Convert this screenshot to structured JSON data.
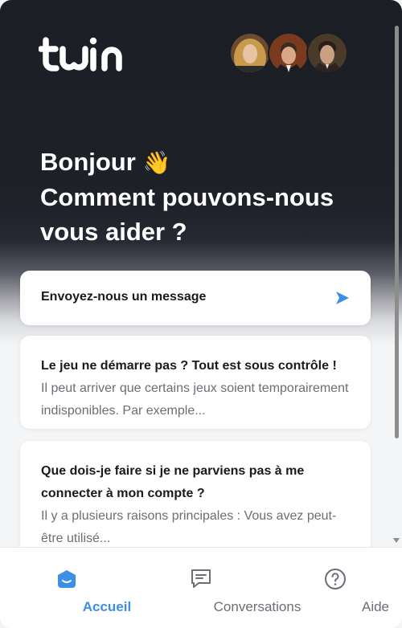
{
  "brand": {
    "logo_text": "twin",
    "accent_color": "#3b8fe6"
  },
  "header": {
    "avatars": [
      {
        "name": "agent-1"
      },
      {
        "name": "agent-2"
      },
      {
        "name": "agent-3"
      }
    ]
  },
  "greeting": {
    "line1": "Bonjour",
    "emoji": "👋",
    "line2": "Comment pouvons-nous vous aider ?"
  },
  "message_card": {
    "label": "Envoyez-nous un message",
    "icon": "send-icon"
  },
  "articles": [
    {
      "title": "Le jeu ne démarre pas ? Tout est sous contrôle !",
      "snippet": "Il peut arriver que certains jeux soient temporairement indisponibles. Par exemple..."
    },
    {
      "title": "Que dois-je faire si je ne parviens pas à me connecter à mon compte ?",
      "snippet": "Il y a plusieurs raisons principales : Vous avez peut-être utilisé..."
    }
  ],
  "nav": {
    "home": {
      "label": "Accueil",
      "icon": "home-icon"
    },
    "conversations": {
      "label": "Conversations",
      "icon": "chat-icon"
    },
    "help": {
      "label": "Aide",
      "icon": "help-icon"
    }
  }
}
